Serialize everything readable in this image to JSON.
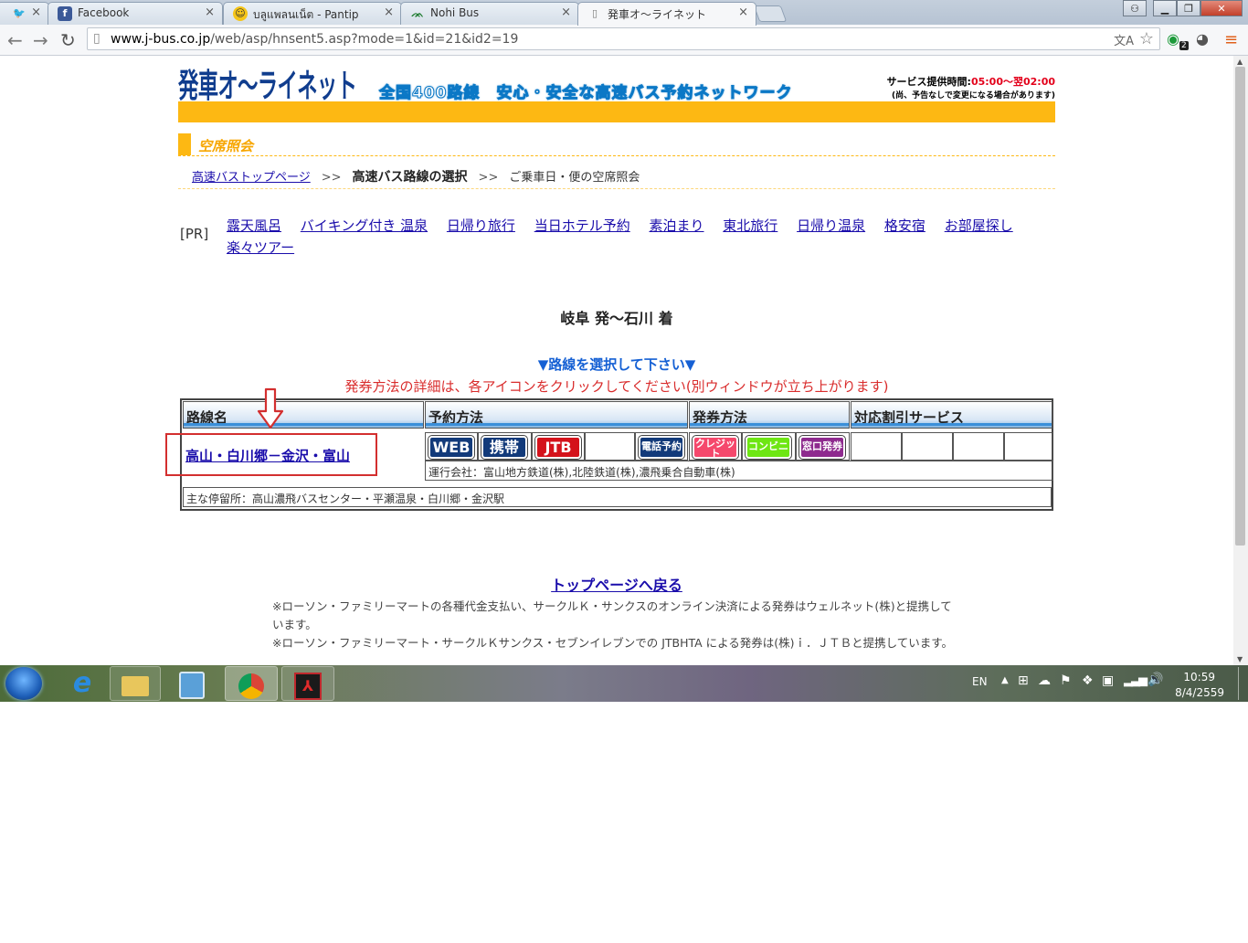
{
  "browser": {
    "tabs": [
      {
        "label": "",
        "icon": "twitter-icon"
      },
      {
        "label": "Facebook",
        "icon": "facebook-icon"
      },
      {
        "label": "บลูแพลนเน็ต - Pantip",
        "icon": "pantip-icon"
      },
      {
        "label": "Nohi Bus",
        "icon": "nohi-icon"
      },
      {
        "label": "発車オ～ライネット",
        "icon": "page-icon"
      }
    ],
    "url_prefix": "www.j-bus.co.jp",
    "url_rest": "/web/asp/hnsent5.asp?mode=1&id=21&id2=19",
    "extension_badge": "2"
  },
  "header": {
    "logo": "発車オ～ライネット",
    "slogan": "全国400路線　安心・安全な高速バス予約ネットワーク",
    "service_label": "サービス提供時間:",
    "service_hours": "05:00～翌02:00",
    "service_note": "(尚、予告なしで変更になる場合があります)",
    "brand_color": "#fdb813"
  },
  "section": {
    "title": "空席照会"
  },
  "breadcrumb": {
    "home": "高速バストップページ",
    "sep": ">>",
    "current": "高速バス路線の選択",
    "next": "ご乗車日・便の空席照会"
  },
  "pr": {
    "tag": "[PR]",
    "links": [
      "露天風呂",
      "バイキング付き 温泉",
      "日帰り旅行",
      "当日ホテル予約",
      "素泊まり",
      "東北旅行",
      "日帰り温泉",
      "格安宿",
      "お部屋探し",
      "楽々ツアー"
    ]
  },
  "route": {
    "title": "岐阜 発～石川 着",
    "prompt": "▼路線を選択して下さい▼",
    "note": "発券方法の詳細は、各アイコンをクリックしてください(別ウィンドウが立ち上がります)"
  },
  "table": {
    "headers": [
      "路線名",
      "予約方法",
      "発券方法",
      "対応割引サービス"
    ],
    "route_name": "高山・白川郷－金沢・富山",
    "reservation": [
      "WEB",
      "携帯",
      "JTB",
      "",
      "電話予約"
    ],
    "ticketing": [
      "クレジット",
      "コンビニ",
      "窓口発券"
    ],
    "operator": "運行会社：富山地方鉄道(株),北陸鉄道(株),濃飛乗合自動車(株)",
    "stops": "主な停留所：高山濃飛バスセンター・平瀬温泉・白川郷・金沢駅"
  },
  "footer": {
    "back_link": "トップページへ戻る",
    "note1": "※ローソン・ファミリーマートの各種代金支払い、サークルＫ・サンクスのオンライン決済による発券はウェルネット(株)と提携しています。",
    "note2": "※ローソン・ファミリーマート・サークルＫサンクス・セブンイレブンでの JTBHTA による発券は(株)ｉ．ＪＴＢと提携しています。"
  },
  "taskbar": {
    "lang": "EN",
    "time": "10:59",
    "date": "8/4/2559"
  }
}
